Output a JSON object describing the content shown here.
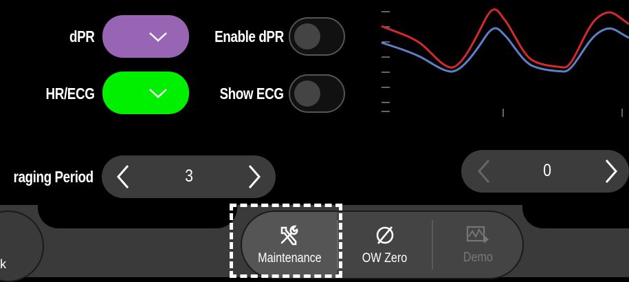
{
  "settings": {
    "dpr_label": "dPR",
    "hr_ecg_label": "HR/ECG",
    "enable_dpr_label": "Enable dPR",
    "show_ecg_label": "Show ECG",
    "averaging_label": "raging Period",
    "averaging_value": "3",
    "right_stepper_value": "0",
    "dpr_color": "#9865B4",
    "hr_ecg_color": "#00F000",
    "enable_dpr_on": false,
    "show_ecg_on": false
  },
  "waveform": {
    "series": [
      {
        "color": "#D22A2E"
      },
      {
        "color": "#5F7FC8"
      }
    ]
  },
  "nav": {
    "maintenance_label": "Maintenance",
    "ow_zero_label": "OW Zero",
    "demo_label": "Demo",
    "left_fragment": "k"
  }
}
